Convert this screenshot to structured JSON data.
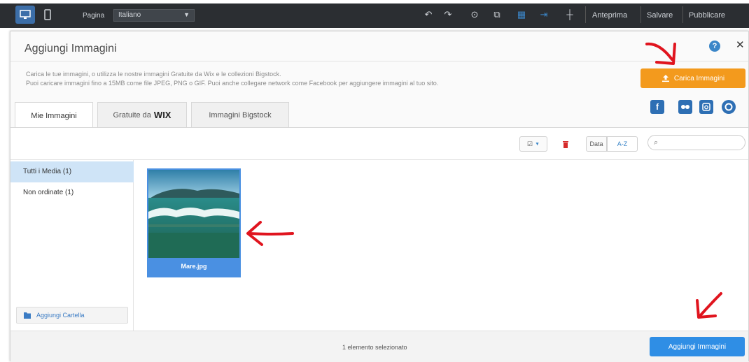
{
  "topbar": {
    "page_label": "Pagina",
    "page_select_value": "Italiano",
    "preview_label": "Anteprima",
    "save_label": "Salvare",
    "publish_label": "Pubblicare",
    "help_label": "?"
  },
  "dialog": {
    "title": "Aggiungi Immagini",
    "description_line1": "Carica le tue immagini, o utilizza le nostre immagini Gratuite da Wix e le collezioni Bigstock.",
    "description_line2": "Puoi caricare immagini fino a 15MB come file JPEG, PNG o GIF. Puoi anche collegare network come Facebook per aggiungere immagini al tuo sito.",
    "upload_button": "Carica Immagini",
    "tabs": [
      {
        "label": "Mie Immagini",
        "active": true
      },
      {
        "label": "Gratuite da",
        "logo": "WIX",
        "active": false
      },
      {
        "label": "Immagini Bigstock",
        "active": false
      }
    ],
    "social_icons": [
      "facebook-icon",
      "flickr-icon",
      "instagram-icon",
      "picasa-icon"
    ],
    "toolbar": {
      "sort_date": "Data",
      "sort_az": "A-Z",
      "search_placeholder": ""
    },
    "sidebar": {
      "items": [
        {
          "label": "Tutti i Media (1)",
          "active": true
        },
        {
          "label": "Non ordinate (1)",
          "active": false
        }
      ],
      "add_folder_label": "Aggiungi Cartella"
    },
    "media": [
      {
        "name": "Mare.jpg",
        "selected": true
      }
    ],
    "footer": {
      "status_text": "1 elemento selezionato",
      "add_button": "Aggiungi Immagini"
    }
  },
  "colors": {
    "accent_orange": "#f39a1d",
    "accent_blue": "#2f8ee5",
    "annotation_red": "#e0141e"
  }
}
